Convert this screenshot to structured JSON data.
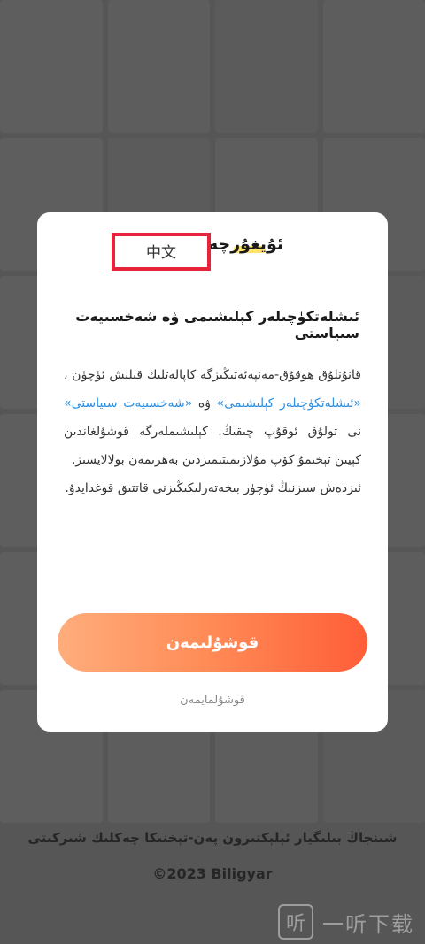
{
  "dialog": {
    "title": "ئۇيغۇرچە",
    "language_option": "中文",
    "subtitle": "ئىشلەتكۈچىلەر كېلىشىمى ۋە شەخسىيەت سىياستى",
    "body_intro": "قانۇنلۇق ھوقۇق-مەنپەئەتىڭىزگە كاپالەتلىك قىلىش ئۈچۈن ، ",
    "link_user_agreement": "«ئىشلەتكۈچىلەر كېلىشىمى»",
    "body_and": " ۋە ",
    "link_privacy_policy": "«شەخسىيەت سىياستى»",
    "body_after": " نى تولۇق ئوقۇپ چىقىڭ. كېلىشىملەرگە قوشۇلغاندىن كېيىن تېخىمۇ كۆپ مۇلازىمىتىمىزدىن بەھرىمەن بولالايسىز.",
    "body_second": "ئىزدەش سىزنىڭ ئۈچۈر بىخەتەرلىكىڭىزنى قاتتىق قوغدايدۇ.",
    "agree_label": "قوشۇلىمەن",
    "decline_label": "قوشۇلمايمەن"
  },
  "footer": {
    "company": "شىنجاڭ بىلىگيار ئېلېكتىرون پەن-تېخنىكا چەكلىك شىركىتى",
    "copyright": "©2023 Biligyar"
  },
  "watermark": {
    "icon_glyph": "听",
    "text": "一听下载"
  }
}
